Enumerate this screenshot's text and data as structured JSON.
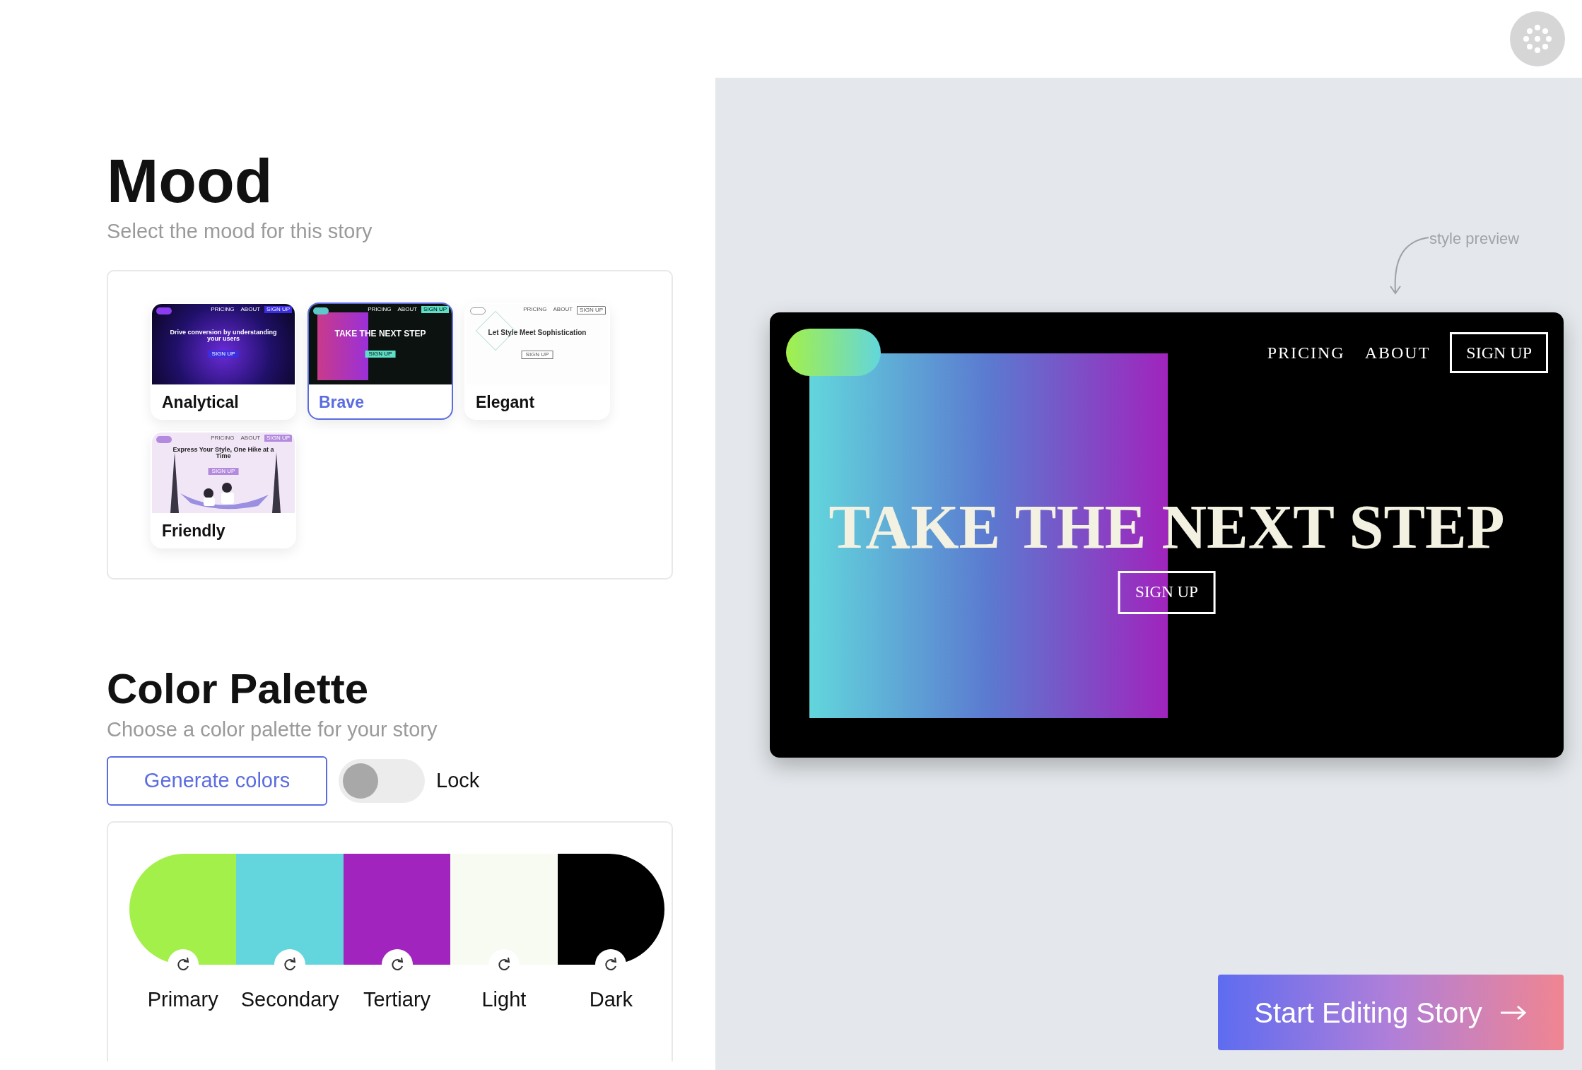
{
  "mood": {
    "title": "Mood",
    "subtitle": "Select the mood for this story",
    "options": [
      {
        "label": "Analytical",
        "selected": false,
        "kind": "analytical",
        "thumbnail": {
          "nav": [
            "PRICING",
            "ABOUT",
            "SIGN UP"
          ],
          "headline": "Drive conversion by understanding your users",
          "button": "SIGN UP"
        }
      },
      {
        "label": "Brave",
        "selected": true,
        "kind": "brave",
        "thumbnail": {
          "nav": [
            "PRICING",
            "ABOUT",
            "SIGN UP"
          ],
          "headline": "TAKE THE NEXT STEP",
          "button": "SIGN UP"
        }
      },
      {
        "label": "Elegant",
        "selected": false,
        "kind": "elegant",
        "thumbnail": {
          "nav": [
            "PRICING",
            "ABOUT",
            "SIGN UP"
          ],
          "headline": "Let Style Meet Sophistication",
          "button": "SIGN UP"
        }
      },
      {
        "label": "Friendly",
        "selected": false,
        "kind": "friendly",
        "thumbnail": {
          "nav": [
            "PRICING",
            "ABOUT",
            "SIGN UP"
          ],
          "headline": "Express Your Style, One Hike at a Time",
          "button": "SIGN UP"
        }
      }
    ]
  },
  "palette": {
    "title": "Color Palette",
    "subtitle": "Choose a color palette for your story",
    "generate_button": "Generate colors",
    "lock": {
      "label": "Lock",
      "on": false
    },
    "swatches": [
      {
        "label": "Primary",
        "color": "#a3f04a"
      },
      {
        "label": "Secondary",
        "color": "#62d6dc"
      },
      {
        "label": "Tertiary",
        "color": "#a024bd"
      },
      {
        "label": "Light",
        "color": "#f7fbf1"
      },
      {
        "label": "Dark",
        "color": "#000000"
      }
    ]
  },
  "preview": {
    "annotation": "style preview",
    "nav": [
      "PRICING",
      "ABOUT"
    ],
    "nav_button": "SIGN UP",
    "headline": "TAKE THE NEXT STEP",
    "button": "SIGN UP"
  },
  "start_button": "Start Editing Story"
}
